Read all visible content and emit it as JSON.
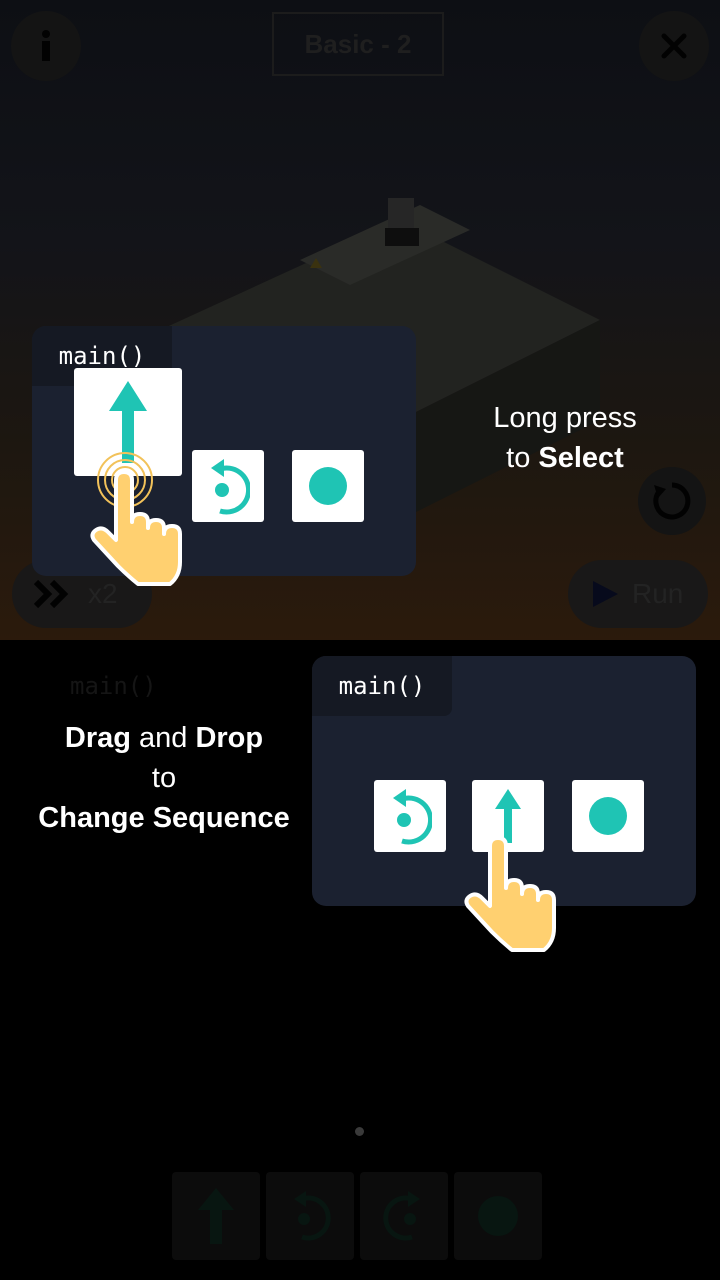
{
  "header": {
    "level_title": "Basic - 2",
    "info_icon": "info-icon",
    "close_icon": "close-icon"
  },
  "controls": {
    "speed_label": "x2",
    "speed_icon": "fast-forward-icon",
    "run_label": "Run",
    "run_icon": "play-icon",
    "reset_icon": "reset-icon"
  },
  "tutorial": {
    "step1": {
      "panel_label": "main()",
      "caption_line1": "Long press",
      "caption_line2_prefix": "to ",
      "caption_line2_bold": "Select",
      "tiles": [
        "arrow-up-icon",
        "turn-left-icon",
        "circle-action-icon"
      ]
    },
    "step2": {
      "panel_label": "main()",
      "caption_drag": "Drag",
      "caption_and": " and ",
      "caption_drop": "Drop",
      "caption_to": "to",
      "caption_change": "Change Sequence",
      "tiles": [
        "turn-left-icon",
        "arrow-up-icon",
        "circle-action-icon"
      ]
    }
  },
  "background": {
    "code_label": "main()"
  },
  "palette": {
    "tiles": [
      "arrow-up-icon",
      "turn-left-icon",
      "turn-right-icon",
      "circle-action-icon"
    ]
  },
  "colors": {
    "accent": "#1fc4b4",
    "panel": "#1b2130",
    "hand": "#ffd070"
  }
}
